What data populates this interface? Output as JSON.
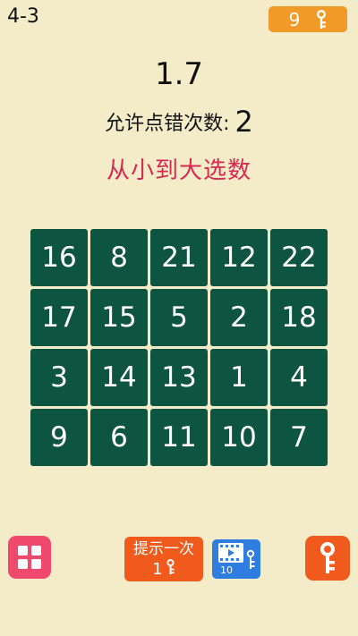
{
  "header": {
    "level": "4-3",
    "key_count": "9"
  },
  "status": {
    "timer": "1.7",
    "errors_label": "允许点错次数:",
    "errors_value": "2",
    "instruction": "从小到大选数"
  },
  "grid": {
    "cells": [
      "16",
      "8",
      "21",
      "12",
      "22",
      "17",
      "15",
      "5",
      "2",
      "18",
      "3",
      "14",
      "13",
      "1",
      "4",
      "9",
      "6",
      "11",
      "10",
      "7"
    ]
  },
  "toolbar": {
    "hint_label": "提示一次",
    "hint_cost": "1",
    "video_reward": "10"
  },
  "colors": {
    "background": "#f4ebc9",
    "tile": "#0d5540",
    "accent_red": "#d62952",
    "orange": "#f15a1d",
    "badge_orange": "#f19a28",
    "pink": "#ef4a6d",
    "blue": "#2f7de0"
  },
  "icons": {
    "key_badge": "key-icon",
    "menu": "grid-menu-icon",
    "hint": "key-icon",
    "video": "video-film-icon",
    "key_button": "key-icon"
  }
}
